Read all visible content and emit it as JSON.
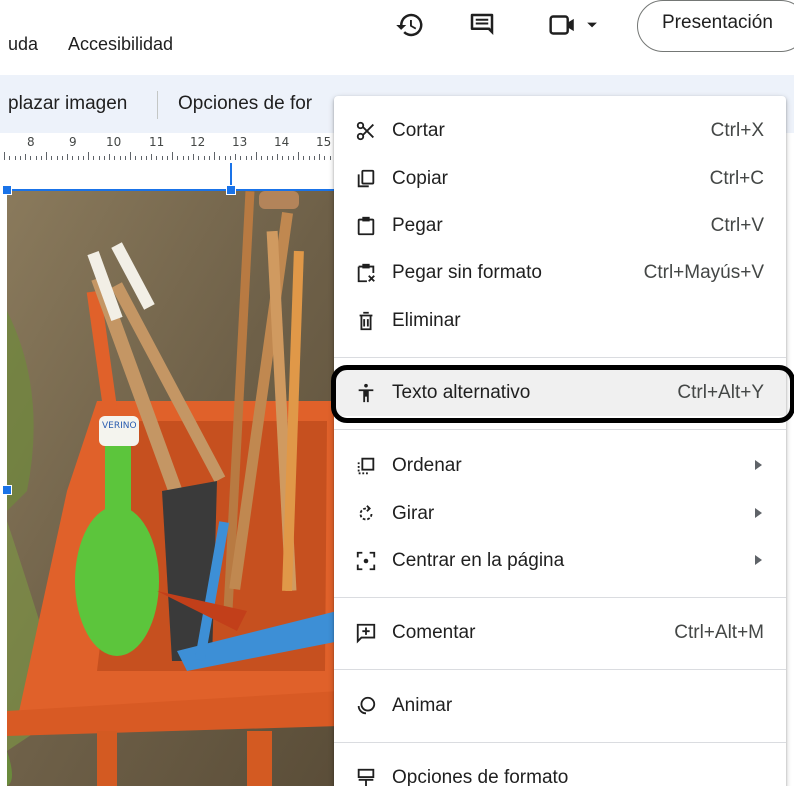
{
  "menubar": {
    "items": [
      "uda",
      "Accesibilidad"
    ]
  },
  "top_icons": [
    "history-icon",
    "comments-icon",
    "video-call-icon"
  ],
  "present": {
    "label": "Presentación"
  },
  "toolbar": {
    "replace_image": "plazar imagen",
    "format_options": "Opciones de for"
  },
  "ruler": {
    "numbers": [
      "8",
      "9",
      "10",
      "11",
      "12",
      "13",
      "14",
      "15"
    ]
  },
  "photo": {
    "label_tag": "VERINO"
  },
  "context_menu": {
    "items": [
      {
        "label": "Cortar",
        "shortcut": "Ctrl+X",
        "icon": "scissors-icon"
      },
      {
        "label": "Copiar",
        "shortcut": "Ctrl+C",
        "icon": "copy-icon"
      },
      {
        "label": "Pegar",
        "shortcut": "Ctrl+V",
        "icon": "clipboard-icon"
      },
      {
        "label": "Pegar sin formato",
        "shortcut": "Ctrl+Mayús+V",
        "icon": "paste-plain-icon"
      },
      {
        "label": "Eliminar",
        "shortcut": "",
        "icon": "trash-icon"
      },
      {
        "label": "Texto alternativo",
        "shortcut": "Ctrl+Alt+Y",
        "icon": "accessibility-icon"
      },
      {
        "label": "Ordenar",
        "shortcut": "",
        "icon": "arrange-icon"
      },
      {
        "label": "Girar",
        "shortcut": "",
        "icon": "rotate-icon"
      },
      {
        "label": "Centrar en la página",
        "shortcut": "",
        "icon": "center-icon"
      },
      {
        "label": "Comentar",
        "shortcut": "Ctrl+Alt+M",
        "icon": "comment-add-icon"
      },
      {
        "label": "Animar",
        "shortcut": "",
        "icon": "animate-icon"
      },
      {
        "label": "Opciones de formato",
        "shortcut": "",
        "icon": "format-options-icon"
      }
    ]
  },
  "colors": {
    "accent": "#1a73e8",
    "toolbar_bg": "#edf2fa",
    "highlight_ring": "#000000"
  }
}
